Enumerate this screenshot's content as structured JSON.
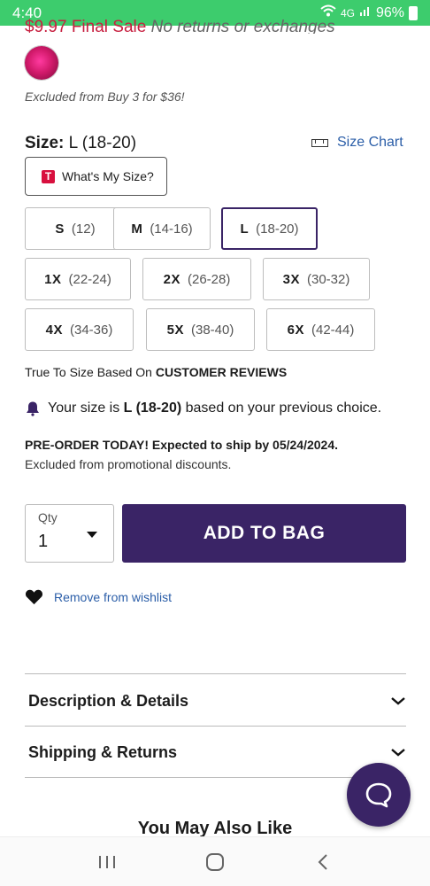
{
  "status_bar": {
    "time": "4:40",
    "signal": "4G",
    "battery": "96%"
  },
  "price_line": {
    "price": "$9.97",
    "final_sale": "Final Sale",
    "note": "No returns or exchanges"
  },
  "promo_excluded": "Excluded from Buy 3 for $36!",
  "size": {
    "label": "Size:",
    "selected": "L (18-20)",
    "chart_label": "Size Chart",
    "whats_my_size": "What's My Size?",
    "whats_my_size_icon_letter": "T",
    "options": [
      {
        "code": "S",
        "range": "(12)"
      },
      {
        "code": "M",
        "range": "(14-16)"
      },
      {
        "code": "L",
        "range": "(18-20)"
      },
      {
        "code": "1X",
        "range": "(22-24)"
      },
      {
        "code": "2X",
        "range": "(26-28)"
      },
      {
        "code": "3X",
        "range": "(30-32)"
      },
      {
        "code": "4X",
        "range": "(34-36)"
      },
      {
        "code": "5X",
        "range": "(38-40)"
      },
      {
        "code": "6X",
        "range": "(42-44)"
      }
    ]
  },
  "true_to_size": {
    "prefix": "True To Size Based On ",
    "bold": "CUSTOMER REVIEWS"
  },
  "size_reminder": {
    "prefix": "Your size is ",
    "size": "L (18-20)",
    "suffix": " based on your previous choice."
  },
  "preorder": "PRE-ORDER TODAY! Expected to ship by 05/24/2024.",
  "promo_note": "Excluded from promotional discounts.",
  "qty": {
    "label": "Qty",
    "value": "1"
  },
  "add_to_bag": "ADD TO BAG",
  "wishlist": "Remove from wishlist",
  "accordion": {
    "description": "Description & Details",
    "shipping": "Shipping & Returns"
  },
  "you_may_also_like": "You May Also Like",
  "colors": {
    "accent": "#3a2466",
    "status_bar": "#3dcc6d",
    "link": "#2b5ea8",
    "sale_red": "#c72040"
  }
}
